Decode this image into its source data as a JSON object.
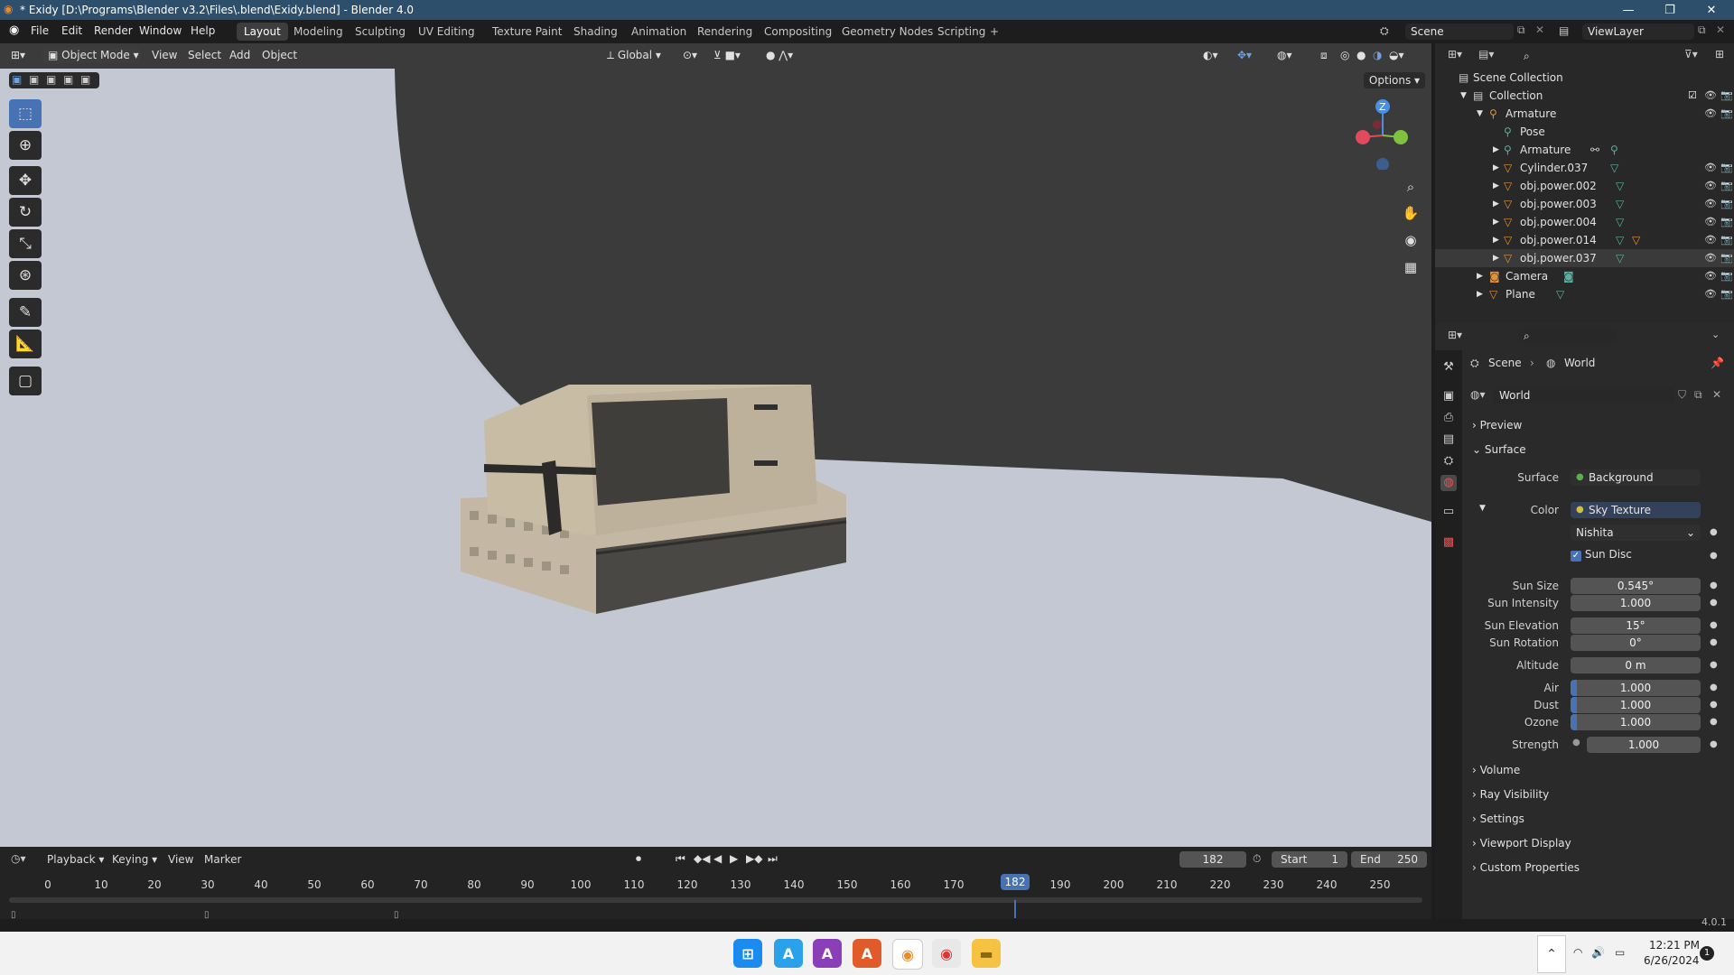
{
  "window": {
    "title": "* Exidy [D:\\Programs\\Blender v3.2\\Files\\.blend\\Exidy.blend] - Blender 4.0",
    "minimize": "—",
    "maximize": "❐",
    "close": "✕"
  },
  "menu": [
    "File",
    "Edit",
    "Render",
    "Window",
    "Help"
  ],
  "workspaces": [
    "Layout",
    "Modeling",
    "Sculpting",
    "UV Editing",
    "Texture Paint",
    "Shading",
    "Animation",
    "Rendering",
    "Compositing",
    "Geometry Nodes",
    "Scripting"
  ],
  "add_workspace": "+",
  "scene_field": "Scene",
  "viewlayer_field": "ViewLayer",
  "viewport": {
    "mode": "Object Mode",
    "menus": [
      "View",
      "Select",
      "Add",
      "Object"
    ],
    "transform_orientation": "Global",
    "options": "Options",
    "gizmo_z": "Z"
  },
  "outliner": {
    "search_placeholder": "",
    "scene_collection": "Scene Collection",
    "items": [
      {
        "name": "Collection",
        "indent": 1
      },
      {
        "name": "Armature",
        "indent": 2
      },
      {
        "name": "Pose",
        "indent": 3
      },
      {
        "name": "Armature",
        "indent": 3
      },
      {
        "name": "Cylinder.037",
        "indent": 3
      },
      {
        "name": "obj.power.002",
        "indent": 3
      },
      {
        "name": "obj.power.003",
        "indent": 3
      },
      {
        "name": "obj.power.004",
        "indent": 3
      },
      {
        "name": "obj.power.014",
        "indent": 3
      },
      {
        "name": "obj.power.037",
        "indent": 3
      },
      {
        "name": "Camera",
        "indent": 2
      },
      {
        "name": "Plane",
        "indent": 2
      }
    ]
  },
  "properties": {
    "breadcrumb_scene": "Scene",
    "breadcrumb_world": "World",
    "world_name": "World",
    "panels": {
      "preview": "Preview",
      "surface": "Surface",
      "volume": "Volume",
      "ray_visibility": "Ray Visibility",
      "settings": "Settings",
      "viewport_display": "Viewport Display",
      "custom_properties": "Custom Properties"
    },
    "surface_label": "Surface",
    "surface_value": "Background",
    "color_label": "Color",
    "color_value": "Sky Texture",
    "sky_type": "Nishita",
    "sun_disc": "Sun Disc",
    "fields": [
      {
        "label": "Sun Size",
        "value": "0.545°"
      },
      {
        "label": "Sun Intensity",
        "value": "1.000"
      },
      {
        "label": "Sun Elevation",
        "value": "15°"
      },
      {
        "label": "Sun Rotation",
        "value": "0°"
      },
      {
        "label": "Altitude",
        "value": "0 m"
      },
      {
        "label": "Air",
        "value": "1.000",
        "level": 0.1
      },
      {
        "label": "Dust",
        "value": "1.000",
        "level": 0.1
      },
      {
        "label": "Ozone",
        "value": "1.000",
        "level": 0.1
      },
      {
        "label": "Strength",
        "value": "1.000"
      }
    ],
    "version": "4.0.1"
  },
  "timeline": {
    "menus": [
      "Playback",
      "Keying",
      "View",
      "Marker"
    ],
    "current_frame": "182",
    "start_label": "Start",
    "start": "1",
    "end_label": "End",
    "end": "250",
    "ticks": [
      "0",
      "10",
      "20",
      "30",
      "40",
      "50",
      "60",
      "70",
      "80",
      "90",
      "100",
      "110",
      "120",
      "130",
      "140",
      "150",
      "160",
      "170",
      "1",
      "190",
      "200",
      "210",
      "220",
      "230",
      "240",
      "250"
    ],
    "playhead": "182"
  },
  "taskbar": {
    "time": "12:21 PM",
    "date": "6/26/2024",
    "notification_count": "1"
  },
  "colors": {
    "accent": "#4772b3",
    "titlebar": "#2d4f6c",
    "playhead": "#4772b3"
  }
}
